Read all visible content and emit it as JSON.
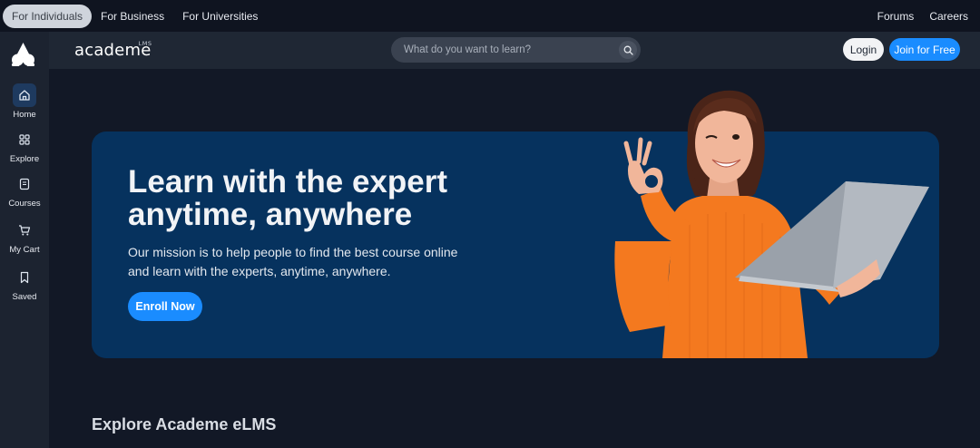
{
  "topbar": {
    "tabs": [
      "For Individuals",
      "For Business",
      "For Universities"
    ],
    "active_tab": "For Individuals",
    "links": [
      "Forums",
      "Careers"
    ]
  },
  "sidebar": {
    "items": [
      {
        "label": "Home",
        "icon": "home-icon",
        "active": true
      },
      {
        "label": "Explore",
        "icon": "grid-icon",
        "active": false
      },
      {
        "label": "Courses",
        "icon": "book-icon",
        "active": false
      },
      {
        "label": "My Cart",
        "icon": "cart-icon",
        "active": false
      },
      {
        "label": "Saved",
        "icon": "bookmark-icon",
        "active": false
      }
    ]
  },
  "header": {
    "brand": "academe",
    "brand_sup": "LMS",
    "search_placeholder": "What do you want to learn?",
    "login_label": "Login",
    "join_label": "Join for Free"
  },
  "hero": {
    "title_line1": "Learn with the expert",
    "title_line2": "anytime, anywhere",
    "description_line1": "Our mission is to help people to find the best course online",
    "description_line2": "and learn with the experts, anytime, anywhere.",
    "cta_label": "Enroll Now",
    "image": "woman-with-laptop-photo"
  },
  "section": {
    "title": "Explore Academe eLMS"
  },
  "colors": {
    "page_bg": "#121826",
    "sidebar_bg": "#1c2330",
    "header_bg": "#1f2734",
    "hero_bg": "#06325e",
    "accent": "#1a8cff"
  }
}
